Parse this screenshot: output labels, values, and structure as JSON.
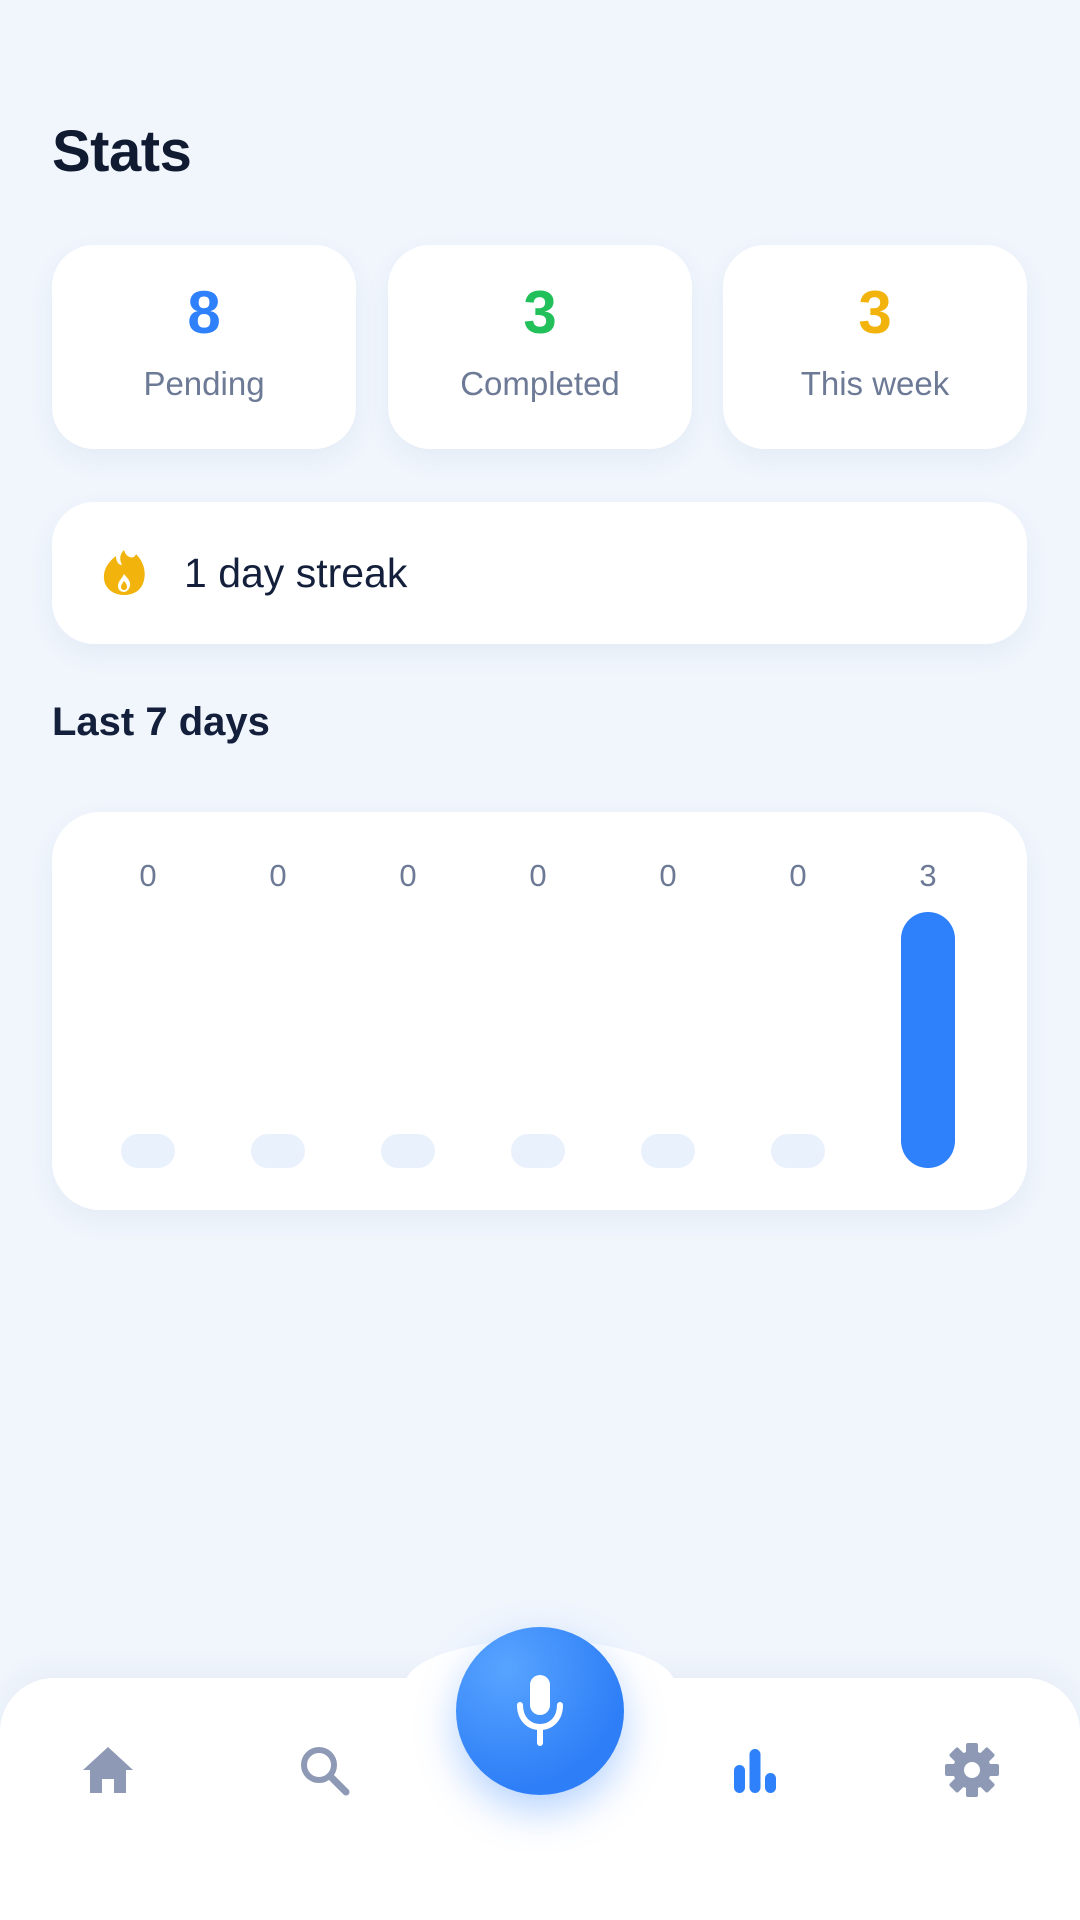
{
  "header": {
    "title": "Stats"
  },
  "stats": [
    {
      "value": "8",
      "label": "Pending",
      "color": "#2f80fb"
    },
    {
      "value": "3",
      "label": "Completed",
      "color": "#22c05a"
    },
    {
      "value": "3",
      "label": "This week",
      "color": "#f2b40c"
    }
  ],
  "streak": {
    "icon": "flame-icon",
    "text": "1 day streak",
    "icon_color": "#f2b40c"
  },
  "chart_section": {
    "title": "Last 7 days"
  },
  "chart_data": {
    "type": "bar",
    "categories": [
      "",
      "",
      "",
      "",
      "",
      "",
      ""
    ],
    "values": [
      0,
      0,
      0,
      0,
      0,
      0,
      3
    ],
    "value_labels": [
      "0",
      "0",
      "0",
      "0",
      "0",
      "0",
      "3"
    ],
    "ylim": [
      0,
      3
    ],
    "grid": false,
    "bar_color": "#2f80fb",
    "empty_bar_color": "#e9f1fd"
  },
  "bottom_nav": {
    "items": [
      {
        "icon": "home-icon",
        "active": false
      },
      {
        "icon": "search-icon",
        "active": false
      },
      {
        "icon": "microphone-icon",
        "active": false
      },
      {
        "icon": "bar-chart-icon",
        "active": true
      },
      {
        "icon": "gear-icon",
        "active": false
      }
    ],
    "active_color": "#2f80fb",
    "inactive_color": "#8e9ab5"
  }
}
